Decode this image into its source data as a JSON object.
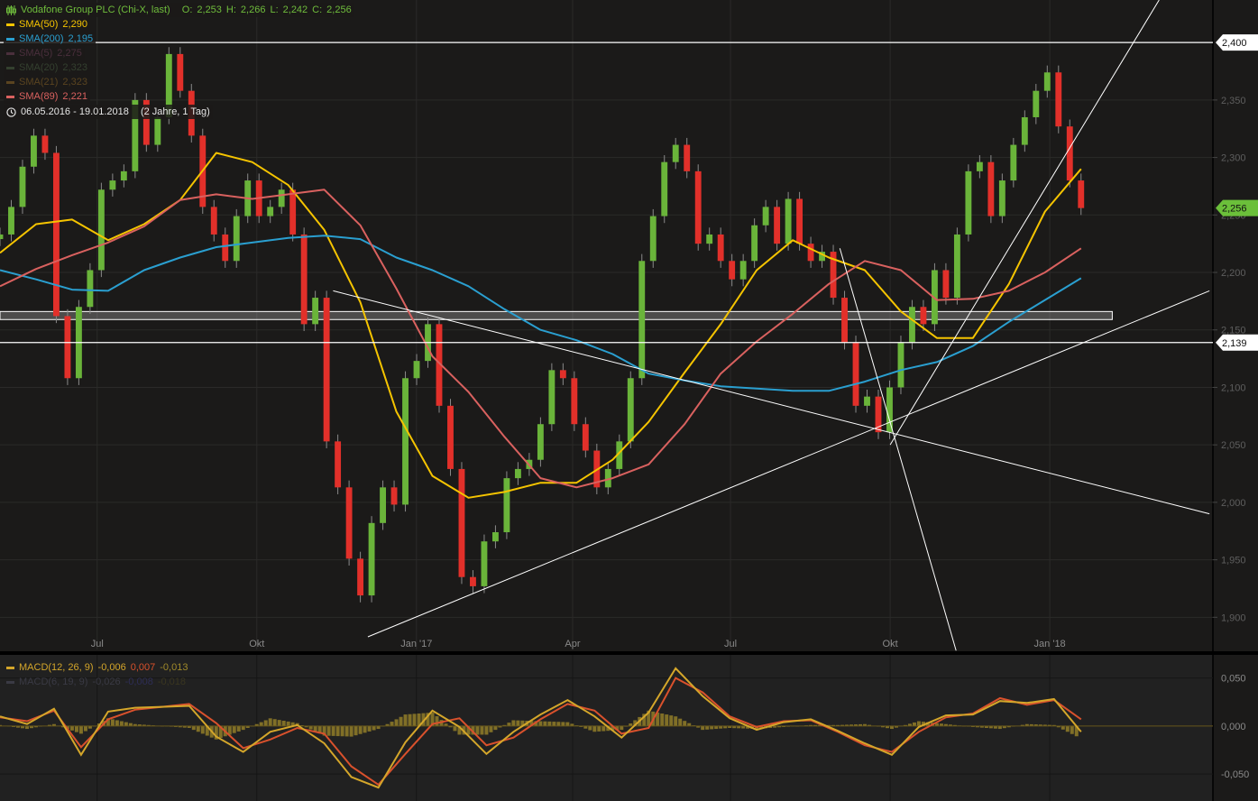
{
  "header": {
    "instrument": "Vodafone Group PLC (Chi-X, last)",
    "ohlc": {
      "open_label": "O:",
      "open": "2,253",
      "high_label": "H:",
      "high": "2,266",
      "low_label": "L:",
      "low": "2,242",
      "close_label": "C:",
      "close": "2,256"
    },
    "indicators": [
      {
        "label": "SMA(50)",
        "value": "2,290",
        "color": "#f5c400"
      },
      {
        "label": "SMA(200)",
        "value": "2,195",
        "color": "#2a9fd0"
      },
      {
        "label": "SMA(5)",
        "value": "2,275",
        "color": "#4a2f3c"
      },
      {
        "label": "SMA(20)",
        "value": "2,323",
        "color": "#34402f"
      },
      {
        "label": "SMA(21)",
        "value": "2,323",
        "color": "#5a4420"
      },
      {
        "label": "SMA(89)",
        "value": "2,221",
        "color": "#d9615f"
      }
    ],
    "date_range": "06.05.2016 - 19.01.2018",
    "duration": "(2 Jahre, 1 Tag)",
    "clock_icon": "clock-icon"
  },
  "macd_legend": [
    {
      "label": "MACD(12, 26, 9)",
      "macd": "-0,006",
      "signal": "0,007",
      "hist": "-0,013",
      "color": "#d4a62a",
      "signal_color": "#d9512c",
      "hist_color": "#a08a2a"
    },
    {
      "label": "MACD(6, 19, 9)",
      "macd": "-0,026",
      "signal": "-0,008",
      "hist": "-0,018",
      "color": "#3a3a44",
      "signal_color": "#2e2e55",
      "hist_color": "#3a3620"
    }
  ],
  "colors": {
    "background": "#1b1a19",
    "up": "#6ab43a",
    "down": "#e2302a",
    "wick": "#8a8a8a",
    "grid": "#2b2a29",
    "annotation": "#ffffff",
    "last_price_tag": "#6bbf3a"
  },
  "chart_data": [
    {
      "type": "candlestick",
      "start_date": "2016-05-06",
      "end_date": "2018-01-19",
      "xlim": [
        "2016-05-06",
        "2018-04-05"
      ],
      "ylim": [
        1.872,
        2.437
      ],
      "grid": true,
      "x_ticks": [
        {
          "date": "2016-07-01",
          "label": "Jul"
        },
        {
          "date": "2016-10-01",
          "label": "Okt"
        },
        {
          "date": "2017-01-01",
          "label": "Jan '17"
        },
        {
          "date": "2017-04-01",
          "label": "Apr"
        },
        {
          "date": "2017-07-01",
          "label": "Jul"
        },
        {
          "date": "2017-10-01",
          "label": "Okt"
        },
        {
          "date": "2018-01-01",
          "label": "Jan '18"
        }
      ],
      "y_ticks": [
        {
          "value": 2.35,
          "label": "2,350"
        },
        {
          "value": 2.3,
          "label": "2,300"
        },
        {
          "value": 2.25,
          "label": "2,250"
        },
        {
          "value": 2.2,
          "label": "2,200"
        },
        {
          "value": 2.15,
          "label": "2,150"
        },
        {
          "value": 2.1,
          "label": "2,100"
        },
        {
          "value": 2.05,
          "label": "2,050"
        },
        {
          "value": 2.0,
          "label": "2,000"
        },
        {
          "value": 1.95,
          "label": "1,950"
        },
        {
          "value": 1.9,
          "label": "1,900"
        }
      ],
      "closes": [
        2.233,
        2.257,
        2.292,
        2.319,
        2.304,
        2.162,
        2.108,
        2.17,
        2.202,
        2.272,
        2.28,
        2.288,
        2.35,
        2.311,
        2.335,
        2.39,
        2.358,
        2.319,
        2.257,
        2.233,
        2.21,
        2.249,
        2.28,
        2.249,
        2.257,
        2.272,
        2.233,
        2.155,
        2.178,
        2.053,
        2.013,
        1.951,
        1.919,
        1.982,
        2.013,
        1.998,
        2.108,
        2.123,
        2.155,
        2.084,
        2.029,
        1.935,
        1.927,
        1.966,
        1.974,
        2.021,
        2.029,
        2.037,
        2.068,
        2.115,
        2.108,
        2.068,
        2.045,
        2.013,
        2.029,
        2.053,
        2.108,
        2.21,
        2.249,
        2.296,
        2.311,
        2.288,
        2.225,
        2.233,
        2.21,
        2.194,
        2.21,
        2.241,
        2.257,
        2.225,
        2.264,
        2.225,
        2.21,
        2.218,
        2.178,
        2.139,
        2.084,
        2.092,
        2.061,
        2.1,
        2.139,
        2.17,
        2.155,
        2.202,
        2.178,
        2.233,
        2.288,
        2.296,
        2.249,
        2.28,
        2.311,
        2.335,
        2.358,
        2.374,
        2.327,
        2.28,
        2.256
      ],
      "series": [
        {
          "name": "SMA(50)",
          "color": "#f5c400",
          "values": [
            2.217,
            2.242,
            2.246,
            2.228,
            2.242,
            2.263,
            2.304,
            2.296,
            2.276,
            2.237,
            2.174,
            2.079,
            2.023,
            2.004,
            2.009,
            2.017,
            2.017,
            2.037,
            2.07,
            2.113,
            2.155,
            2.202,
            2.228,
            2.213,
            2.202,
            2.166,
            2.143,
            2.143,
            2.19,
            2.253,
            2.29
          ]
        },
        {
          "name": "SMA(200)",
          "color": "#2a9fd0",
          "values": [
            2.202,
            2.194,
            2.185,
            2.184,
            2.202,
            2.213,
            2.222,
            2.226,
            2.23,
            2.232,
            2.229,
            2.213,
            2.202,
            2.188,
            2.168,
            2.15,
            2.141,
            2.129,
            2.112,
            2.106,
            2.101,
            2.099,
            2.097,
            2.097,
            2.105,
            2.115,
            2.122,
            2.136,
            2.157,
            2.176,
            2.195
          ]
        },
        {
          "name": "SMA(89)",
          "color": "#d9615f",
          "values": [
            2.188,
            2.203,
            2.215,
            2.226,
            2.24,
            2.263,
            2.268,
            2.264,
            2.268,
            2.272,
            2.241,
            2.186,
            2.127,
            2.096,
            2.057,
            2.021,
            2.013,
            2.021,
            2.033,
            2.068,
            2.112,
            2.14,
            2.164,
            2.19,
            2.21,
            2.202,
            2.176,
            2.177,
            2.184,
            2.2,
            2.221
          ]
        }
      ],
      "horizontal_lines": [
        {
          "value": 2.4,
          "label": "2,400"
        },
        {
          "value": 2.139,
          "label": "2,139"
        }
      ],
      "last_price": {
        "value": 2.256,
        "label": "2,256"
      },
      "zone": {
        "from_date": "2016-05-06",
        "to_date": "2018-02-06",
        "low": 2.159,
        "high": 2.166
      },
      "trend_lines": [
        {
          "from": [
            "2016-11-14",
            2.184
          ],
          "to": [
            "2018-04-03",
            1.99
          ]
        },
        {
          "from": [
            "2016-12-04",
            1.883
          ],
          "to": [
            "2018-04-03",
            2.184
          ]
        },
        {
          "from": [
            "2017-09-02",
            2.221
          ],
          "to": [
            "2017-11-08",
            1.871
          ]
        },
        {
          "from": [
            "2017-10-01",
            2.05
          ],
          "to": [
            "2018-03-05",
            2.437
          ]
        }
      ]
    },
    {
      "type": "line",
      "title": "MACD(12, 26, 9)",
      "start_date": "2016-05-06",
      "end_date": "2018-01-19",
      "ylim": [
        -0.078,
        0.074
      ],
      "y_ticks": [
        {
          "value": 0.05,
          "label": "0,050"
        },
        {
          "value": 0.0,
          "label": "0,000"
        },
        {
          "value": -0.05,
          "label": "-0,050"
        }
      ],
      "macd": [
        0.01,
        0.002,
        0.018,
        -0.03,
        0.015,
        0.019,
        0.02,
        0.021,
        -0.011,
        -0.027,
        -0.006,
        0.001,
        -0.018,
        -0.053,
        -0.064,
        -0.017,
        0.016,
        -0.001,
        -0.029,
        -0.006,
        0.012,
        0.027,
        0.01,
        -0.012,
        0.014,
        0.06,
        0.031,
        0.008,
        -0.004,
        0.004,
        0.007,
        -0.005,
        -0.018,
        -0.03,
        -0.001,
        0.011,
        0.012,
        0.026,
        0.024,
        0.028,
        -0.006
      ],
      "signal": [
        0.009,
        0.005,
        0.016,
        -0.022,
        0.007,
        0.017,
        0.02,
        0.023,
        0.003,
        -0.023,
        -0.014,
        -0.002,
        -0.008,
        -0.042,
        -0.061,
        -0.029,
        0.002,
        0.008,
        -0.02,
        -0.012,
        0.007,
        0.023,
        0.016,
        -0.008,
        -0.002,
        0.05,
        0.035,
        0.01,
        -0.001,
        0.005,
        0.006,
        -0.006,
        -0.02,
        -0.027,
        -0.006,
        0.009,
        0.013,
        0.029,
        0.022,
        0.027,
        0.007
      ]
    }
  ]
}
